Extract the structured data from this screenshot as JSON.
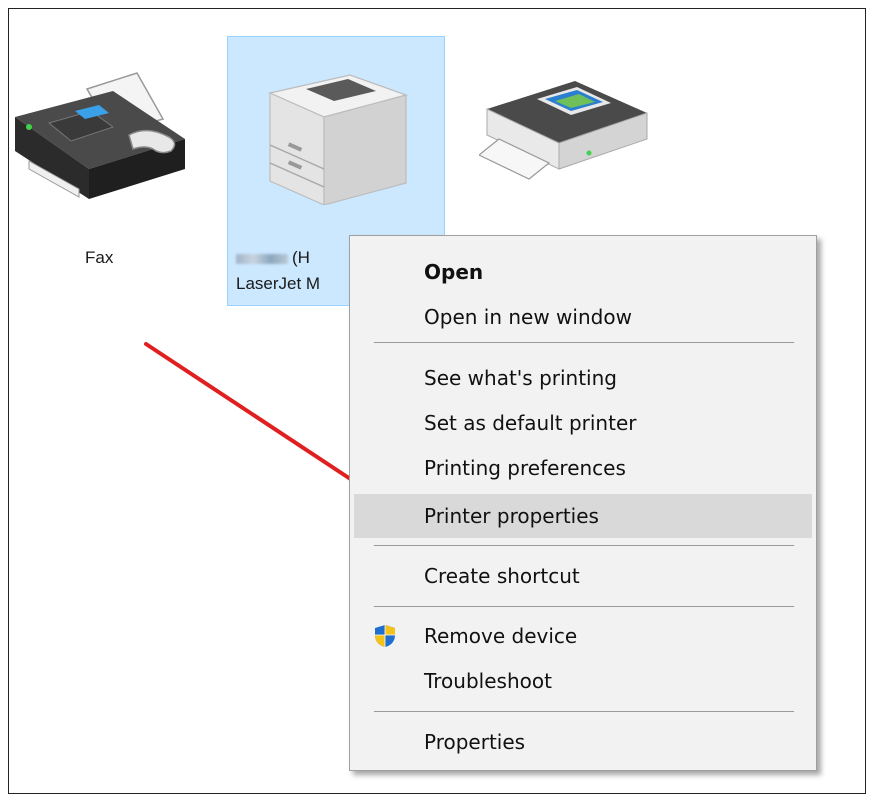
{
  "devices": [
    {
      "label": "Fax",
      "icon": "fax-icon"
    },
    {
      "label_suffix": "(H",
      "label_line2": "LaserJet M",
      "icon": "laser-printer-icon",
      "selected": true
    },
    {
      "icon": "printer-icon"
    }
  ],
  "context_menu": {
    "items": [
      {
        "label": "Open",
        "bold": true
      },
      {
        "label": "Open in new window"
      },
      {
        "label": "See what's printing"
      },
      {
        "label": "Set as default printer"
      },
      {
        "label": "Printing preferences"
      },
      {
        "label": "Printer properties",
        "highlighted": true
      },
      {
        "label": "Create shortcut"
      },
      {
        "label": "Remove device",
        "icon": "uac-shield-icon"
      },
      {
        "label": "Troubleshoot"
      },
      {
        "label": "Properties"
      }
    ]
  },
  "colors": {
    "selection_bg": "#cce8ff",
    "selection_border": "#99d1ff",
    "menu_bg": "#f2f2f2",
    "menu_hover": "#d9d9d9",
    "arrow": "#e02020"
  }
}
